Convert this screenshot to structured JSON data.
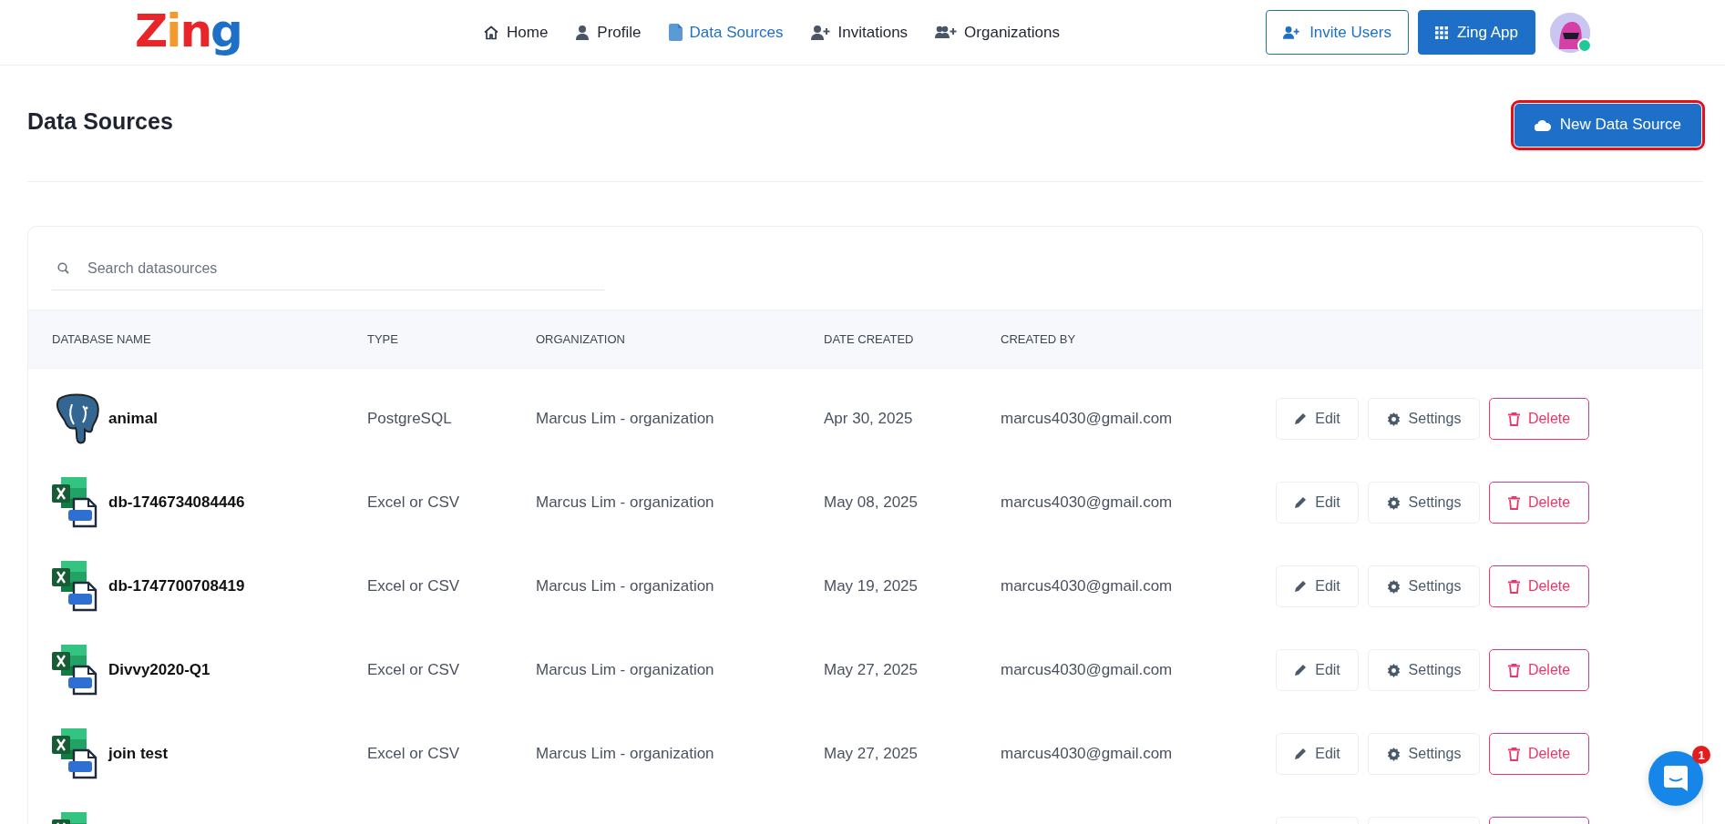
{
  "logo": "Zing",
  "nav": [
    {
      "label": "Home",
      "kind": "home",
      "selected": false
    },
    {
      "label": "Profile",
      "kind": "profile",
      "selected": false
    },
    {
      "label": "Data Sources",
      "kind": "sources",
      "selected": true
    },
    {
      "label": "Invitations",
      "kind": "invitations",
      "selected": false
    },
    {
      "label": "Organizations",
      "kind": "organizations",
      "selected": false
    }
  ],
  "header_buttons": [
    {
      "label": "Invite Users",
      "kind": "outline"
    },
    {
      "label": "Zing App",
      "kind": "solid"
    }
  ],
  "user": {
    "online": true
  },
  "page_title": "Data Sources",
  "new_button": {
    "label": "New Data Source",
    "highlighted": true
  },
  "search": {
    "placeholder": "Search datasources"
  },
  "table": {
    "columns": [
      "DATABASE NAME",
      "TYPE",
      "ORGANIZATION",
      "DATE CREATED",
      "CREATED BY"
    ],
    "rows": [
      {
        "kind": "postgres",
        "name": "animal",
        "type": "PostgreSQL",
        "organization": "Marcus Lim - organization",
        "date_created": "Apr 30, 2025",
        "created_by": "marcus4030@gmail.com",
        "actions": [
          {
            "kind": "edit",
            "label": "Edit"
          },
          {
            "kind": "settings",
            "label": "Settings"
          },
          {
            "kind": "delete",
            "label": "Delete"
          }
        ]
      },
      {
        "kind": "excel",
        "name": "db-1746734084446",
        "type": "Excel or CSV",
        "organization": "Marcus Lim - organization",
        "date_created": "May 08, 2025",
        "created_by": "marcus4030@gmail.com",
        "actions": [
          {
            "kind": "edit",
            "label": "Edit"
          },
          {
            "kind": "settings",
            "label": "Settings"
          },
          {
            "kind": "delete",
            "label": "Delete"
          }
        ]
      },
      {
        "kind": "excel",
        "name": "db-1747700708419",
        "type": "Excel or CSV",
        "organization": "Marcus Lim - organization",
        "date_created": "May 19, 2025",
        "created_by": "marcus4030@gmail.com",
        "actions": [
          {
            "kind": "edit",
            "label": "Edit"
          },
          {
            "kind": "settings",
            "label": "Settings"
          },
          {
            "kind": "delete",
            "label": "Delete"
          }
        ]
      },
      {
        "kind": "excel",
        "name": "Divvy2020-Q1",
        "type": "Excel or CSV",
        "organization": "Marcus Lim - organization",
        "date_created": "May 27, 2025",
        "created_by": "marcus4030@gmail.com",
        "actions": [
          {
            "kind": "edit",
            "label": "Edit"
          },
          {
            "kind": "settings",
            "label": "Settings"
          },
          {
            "kind": "delete",
            "label": "Delete"
          }
        ]
      },
      {
        "kind": "excel",
        "name": "join test",
        "type": "Excel or CSV",
        "organization": "Marcus Lim - organization",
        "date_created": "May 27, 2025",
        "created_by": "marcus4030@gmail.com",
        "actions": [
          {
            "kind": "edit",
            "label": "Edit"
          },
          {
            "kind": "settings",
            "label": "Settings"
          },
          {
            "kind": "delete",
            "label": "Delete"
          }
        ]
      },
      {
        "kind": "excel",
        "actions": [
          {
            "kind": "edit"
          },
          {
            "kind": "settings"
          },
          {
            "kind": "delete"
          }
        ]
      }
    ]
  },
  "chat": {
    "badge": "1"
  }
}
